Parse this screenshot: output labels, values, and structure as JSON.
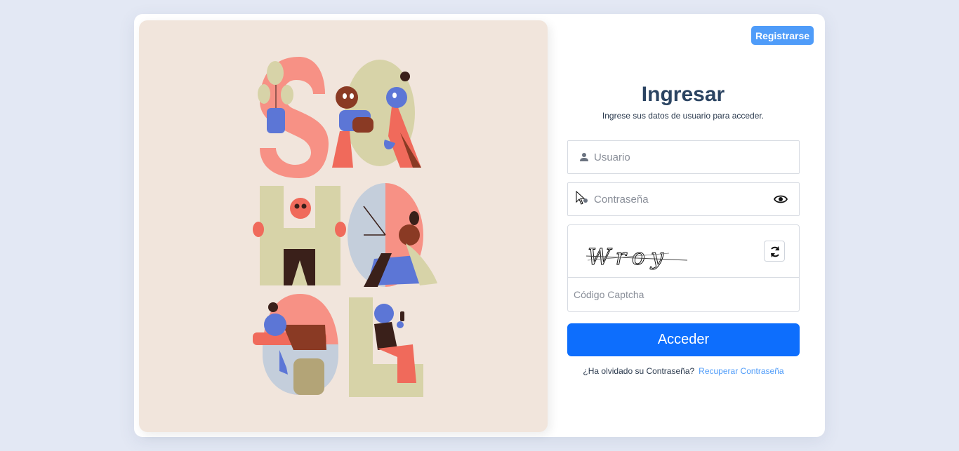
{
  "header": {
    "register_label": "Registrarse"
  },
  "login": {
    "title": "Ingresar",
    "subtitle": "Ingrese sus datos de usuario para acceder.",
    "username_placeholder": "Usuario",
    "password_placeholder": "Contraseña",
    "captcha_text": "Wroy",
    "captcha_placeholder": "Código Captcha",
    "submit_label": "Acceder",
    "forgot_text": "¿Ha olvidado su Contraseña?",
    "recover_link": "Recuperar Contraseña"
  },
  "illustration": {
    "letters": "SAHAOL"
  },
  "colors": {
    "background": "#e3e8f4",
    "panel": "#f1e5dc",
    "primary": "#0d6efd",
    "accent": "#4f9cf9",
    "title": "#2b4462",
    "salmon": "#f79185",
    "beige": "#d7d3a8",
    "blue_figure": "#5c76d6",
    "brown": "#3a201a"
  },
  "icons": {
    "user": "user-icon",
    "lock": "lock-icon",
    "eye": "eye-icon",
    "refresh": "refresh-icon"
  }
}
